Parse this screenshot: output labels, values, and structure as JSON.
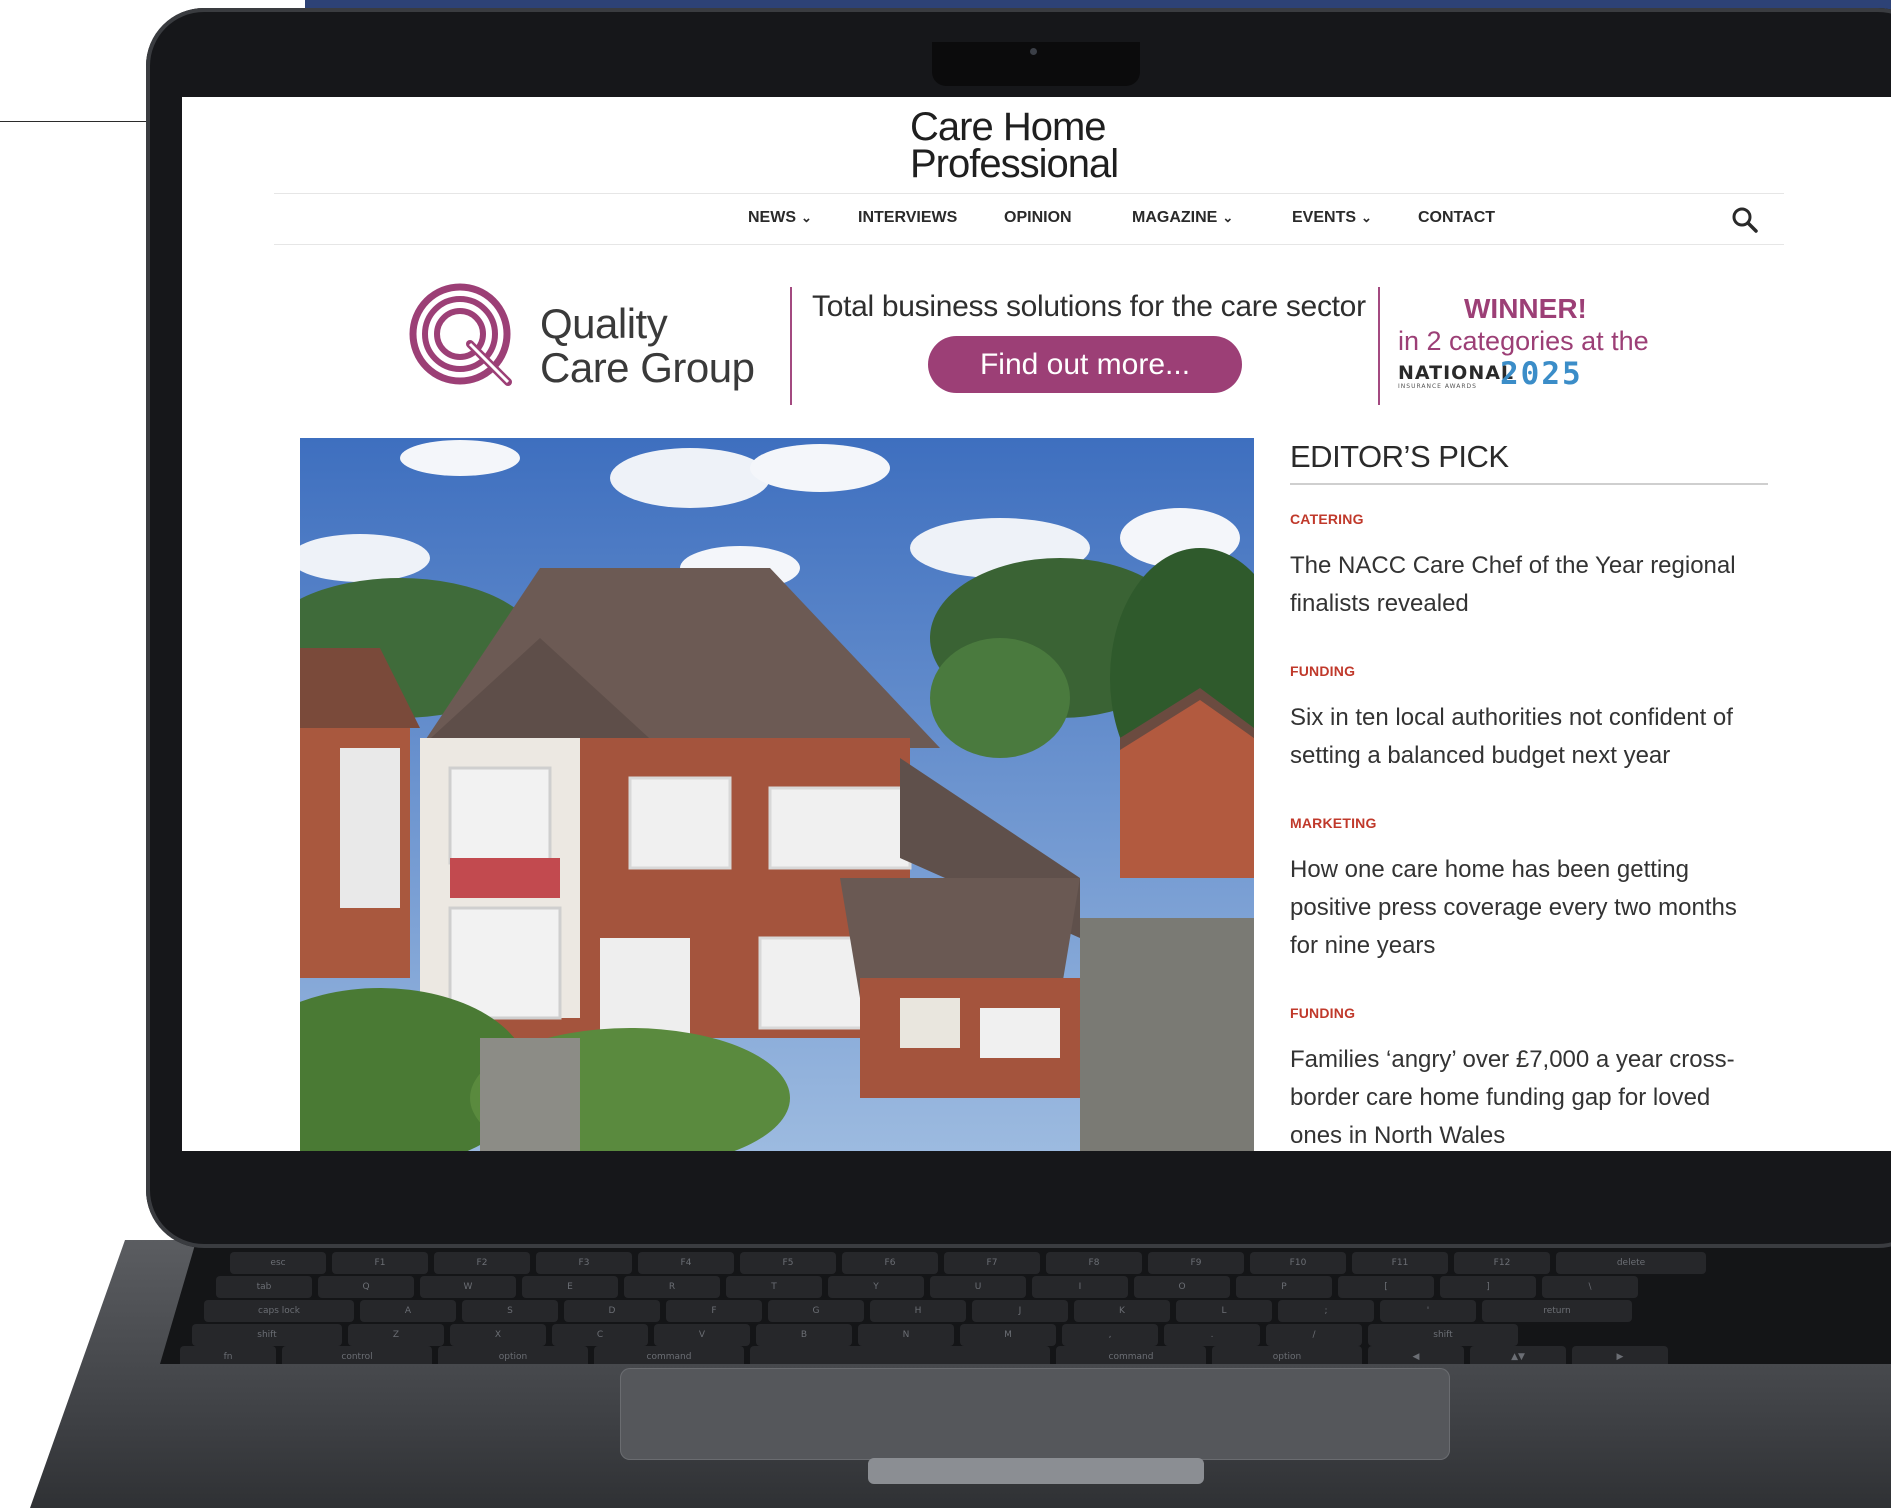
{
  "site": {
    "logo_line1": "Care Home",
    "logo_line2": "Professional"
  },
  "nav": {
    "items": [
      {
        "label": "NEWS",
        "dropdown": true
      },
      {
        "label": "INTERVIEWS",
        "dropdown": false
      },
      {
        "label": "OPINION",
        "dropdown": false
      },
      {
        "label": "MAGAZINE",
        "dropdown": true
      },
      {
        "label": "EVENTS",
        "dropdown": true
      },
      {
        "label": "CONTACT",
        "dropdown": false
      }
    ],
    "search_icon": "search-icon"
  },
  "ad": {
    "brand_line1": "Quality",
    "brand_line2": "Care Group",
    "tagline": "Total business solutions for the care sector",
    "button_label": "Find out more...",
    "winner": "WINNER!",
    "winner_detail": "in 2 categories at the",
    "award_name": "NATIONAL",
    "award_sub": "INSURANCE AWARDS",
    "award_year": "2025",
    "accent_color": "#9c3f76",
    "year_color": "#3b8dc8"
  },
  "hero": {
    "image": "care home building photo"
  },
  "editors_pick": {
    "title": "EDITOR’S PICK",
    "items": [
      {
        "category": "CATERING",
        "headline": "The NACC Care Chef of the Year regional finalists revealed"
      },
      {
        "category": "FUNDING",
        "headline": "Six in ten local authorities not confident of setting a balanced budget next year"
      },
      {
        "category": "MARKETING",
        "headline": "How one care home has been getting positive press coverage every two months for nine years"
      },
      {
        "category": "FUNDING",
        "headline": "Families ‘angry’ over £7,000 a year cross-border care home funding gap for loved ones in North Wales"
      }
    ],
    "category_color": "#c0392b"
  },
  "keyboard": {
    "row1": [
      "esc",
      "F1",
      "F2",
      "F3",
      "F4",
      "F5",
      "F6",
      "F7",
      "F8",
      "F9",
      "F10",
      "F11",
      "F12",
      "delete"
    ],
    "row2": [
      "tab",
      "Q",
      "W",
      "E",
      "R",
      "T",
      "Y",
      "U",
      "I",
      "O",
      "P",
      "[",
      "]",
      "\\"
    ],
    "row3": [
      "caps lock",
      "A",
      "S",
      "D",
      "F",
      "G",
      "H",
      "J",
      "K",
      "L",
      ";",
      "'",
      "return"
    ],
    "row4": [
      "shift",
      "Z",
      "X",
      "C",
      "V",
      "B",
      "N",
      "M",
      ",",
      ".",
      "/",
      "shift"
    ],
    "row5": [
      "fn",
      "control",
      "option",
      "command",
      "",
      "command",
      "option",
      "◀",
      "▲▼",
      "▶"
    ]
  }
}
